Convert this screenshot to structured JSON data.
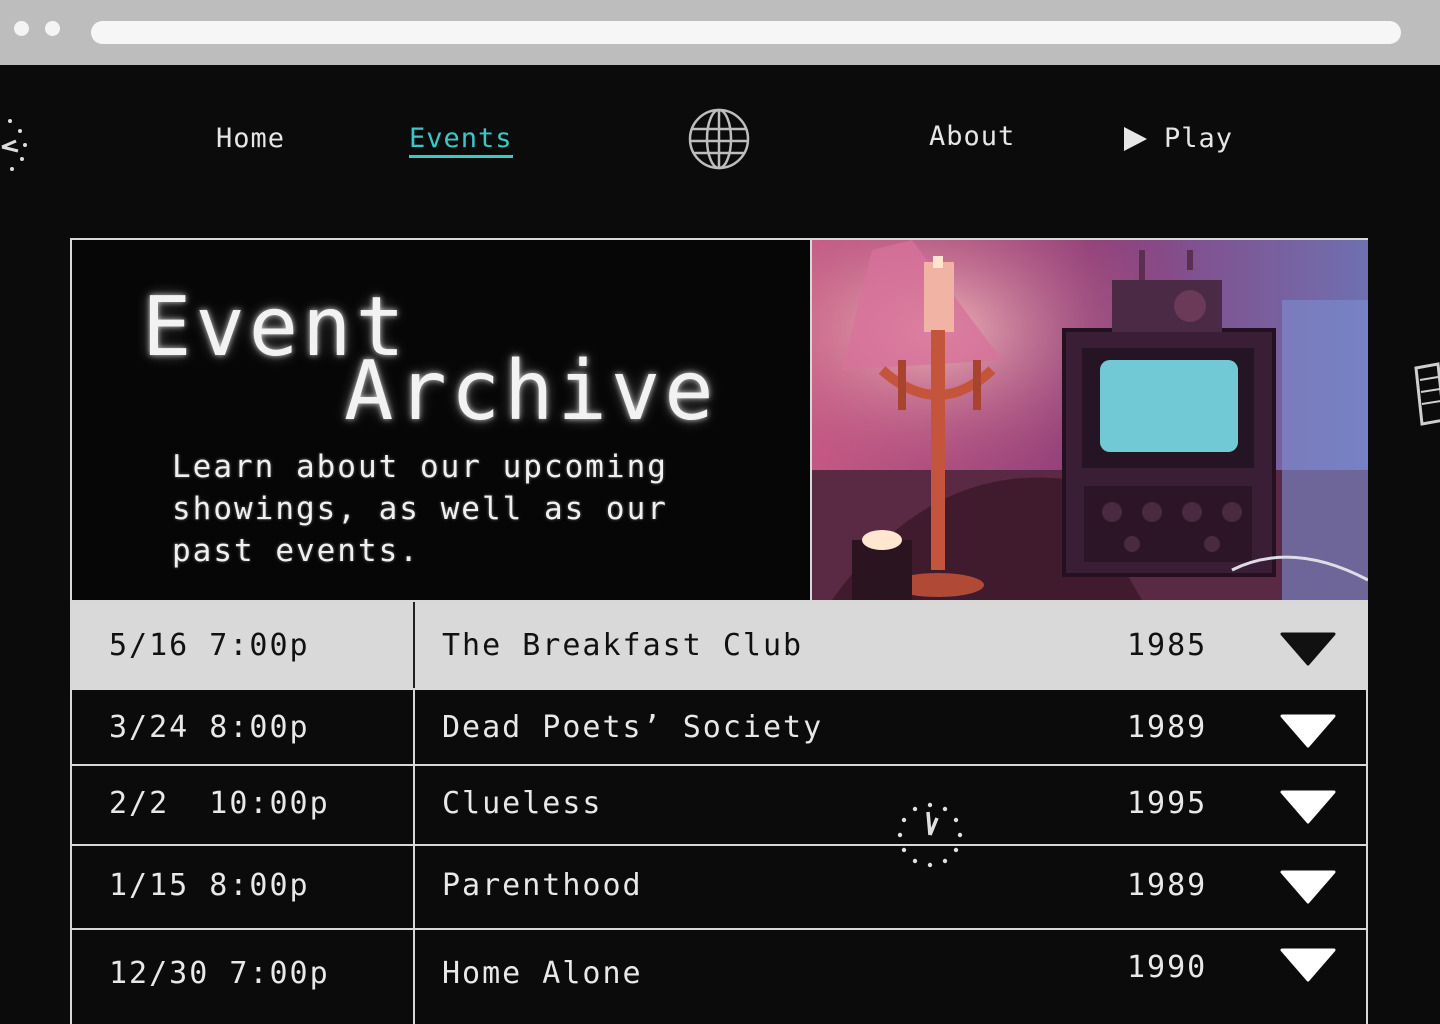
{
  "nav": {
    "home_label": "Home",
    "events_label": "Events",
    "about_label": "About",
    "play_label": "Play",
    "active_color": "#39c9c4",
    "center_icon": "globe-icon",
    "play_icon": "play-icon"
  },
  "hero": {
    "title_line1": "Event",
    "title_line2": "Archive",
    "description": "Learn about our upcoming showings, as well as our past events.",
    "image_icon": "candle-and-tv-photo"
  },
  "events": [
    {
      "date": "5/16 7:00p",
      "title": "The Breakfast Club",
      "year": "1985",
      "expanded": true
    },
    {
      "date": "3/24 8:00p",
      "title": "Dead Poets’ Society",
      "year": "1989",
      "expanded": false
    },
    {
      "date": "2/2  10:00p",
      "title": "Clueless",
      "year": "1995",
      "expanded": false
    },
    {
      "date": "1/15 8:00p",
      "title": "Parenthood",
      "year": "1989",
      "expanded": false
    },
    {
      "date": "12/30 7:00p",
      "title": "Home Alone",
      "year": "1990",
      "expanded": false
    }
  ]
}
